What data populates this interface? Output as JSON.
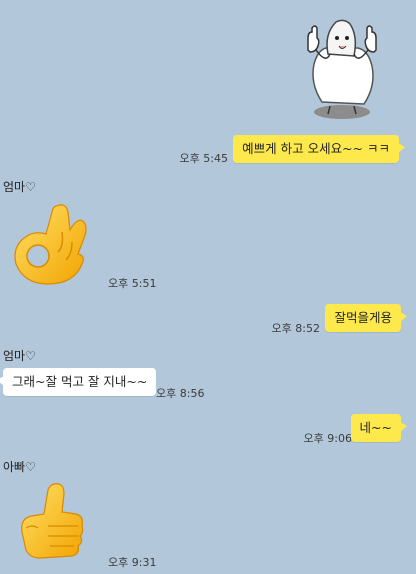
{
  "colors": {
    "background": "#b2c7da",
    "outgoing_bubble": "#fee94c",
    "incoming_bubble": "#ffffff"
  },
  "messages": [
    {
      "direction": "out",
      "type": "sticker",
      "sticker": "thumbs-up-character-sticker",
      "time": ""
    },
    {
      "direction": "out",
      "type": "text",
      "text": "예쁘게 하고 오세요~~ ㅋㅋ",
      "time": "오후 5:45"
    },
    {
      "direction": "in",
      "sender": "엄마♡",
      "type": "emoji",
      "emoji": "ok-hand-emoji",
      "time": "오후 5:51"
    },
    {
      "direction": "out",
      "type": "text",
      "text": "잘먹을게용",
      "time": "오후 8:52"
    },
    {
      "direction": "in",
      "sender": "엄마♡",
      "type": "text",
      "text": "그래~잘 먹고 잘 지내~~",
      "time": "오후 8:56"
    },
    {
      "direction": "out",
      "type": "text",
      "text": "네~~",
      "time": "오후 9:06"
    },
    {
      "direction": "in",
      "sender": "아빠♡",
      "type": "emoji",
      "emoji": "thumbs-up-emoji",
      "time": "오후 9:31"
    }
  ]
}
